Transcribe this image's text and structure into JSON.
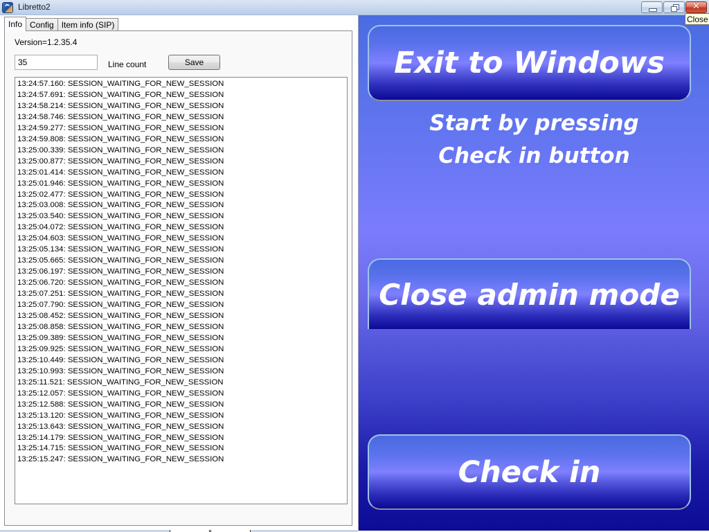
{
  "window": {
    "title": "Libretto2",
    "icon": "libretto-app-icon",
    "controls": {
      "minimize": "minimize-icon",
      "maximize": "restore-icon",
      "close": "close-icon",
      "close_glyph": "✕"
    },
    "tooltip": "Close"
  },
  "tabs": [
    {
      "label": "Info",
      "active": true
    },
    {
      "label": "Config",
      "active": false
    },
    {
      "label": "Item info (SIP)",
      "active": false
    }
  ],
  "info": {
    "version": "Version=1.2.35.4",
    "line_count_value": "35",
    "line_count_label": "Line count",
    "save_label": "Save",
    "log": [
      "13:24:57.160: SESSION_WAITING_FOR_NEW_SESSION",
      "13:24:57.691: SESSION_WAITING_FOR_NEW_SESSION",
      "13:24:58.214: SESSION_WAITING_FOR_NEW_SESSION",
      "13:24:58.746: SESSION_WAITING_FOR_NEW_SESSION",
      "13:24:59.277: SESSION_WAITING_FOR_NEW_SESSION",
      "13:24:59.808: SESSION_WAITING_FOR_NEW_SESSION",
      "13:25:00.339: SESSION_WAITING_FOR_NEW_SESSION",
      "13:25:00.877: SESSION_WAITING_FOR_NEW_SESSION",
      "13:25:01.414: SESSION_WAITING_FOR_NEW_SESSION",
      "13:25:01.946: SESSION_WAITING_FOR_NEW_SESSION",
      "13:25:02.477: SESSION_WAITING_FOR_NEW_SESSION",
      "13:25:03.008: SESSION_WAITING_FOR_NEW_SESSION",
      "13:25:03.540: SESSION_WAITING_FOR_NEW_SESSION",
      "13:25:04.072: SESSION_WAITING_FOR_NEW_SESSION",
      "13:25:04.603: SESSION_WAITING_FOR_NEW_SESSION",
      "13:25:05.134: SESSION_WAITING_FOR_NEW_SESSION",
      "13:25:05.665: SESSION_WAITING_FOR_NEW_SESSION",
      "13:25:06.197: SESSION_WAITING_FOR_NEW_SESSION",
      "13:25:06.720: SESSION_WAITING_FOR_NEW_SESSION",
      "13:25:07.251: SESSION_WAITING_FOR_NEW_SESSION",
      "13:25:07.790: SESSION_WAITING_FOR_NEW_SESSION",
      "13:25:08.452: SESSION_WAITING_FOR_NEW_SESSION",
      "13:25:08.858: SESSION_WAITING_FOR_NEW_SESSION",
      "13:25:09.389: SESSION_WAITING_FOR_NEW_SESSION",
      "13:25:09.925: SESSION_WAITING_FOR_NEW_SESSION",
      "13:25:10.449: SESSION_WAITING_FOR_NEW_SESSION",
      "13:25:10.993: SESSION_WAITING_FOR_NEW_SESSION",
      "13:25:11.521: SESSION_WAITING_FOR_NEW_SESSION",
      "13:25:12.057: SESSION_WAITING_FOR_NEW_SESSION",
      "13:25:12.588: SESSION_WAITING_FOR_NEW_SESSION",
      "13:25:13.120: SESSION_WAITING_FOR_NEW_SESSION",
      "13:25:13.643: SESSION_WAITING_FOR_NEW_SESSION",
      "13:25:14.179: SESSION_WAITING_FOR_NEW_SESSION",
      "13:25:14.715: SESSION_WAITING_FOR_NEW_SESSION",
      "13:25:15.247: SESSION_WAITING_FOR_NEW_SESSION"
    ]
  },
  "kiosk": {
    "exit_label": "Exit to Windows",
    "instructions_line1": "Start by pressing",
    "instructions_line2": "Check in button",
    "close_admin_label": "Close admin mode",
    "checkin_label": "Check in",
    "colors": {
      "bg_top": "#4a6ce2",
      "bg_mid": "#7b7cfd",
      "bg_bottom": "#0c0c96"
    }
  }
}
